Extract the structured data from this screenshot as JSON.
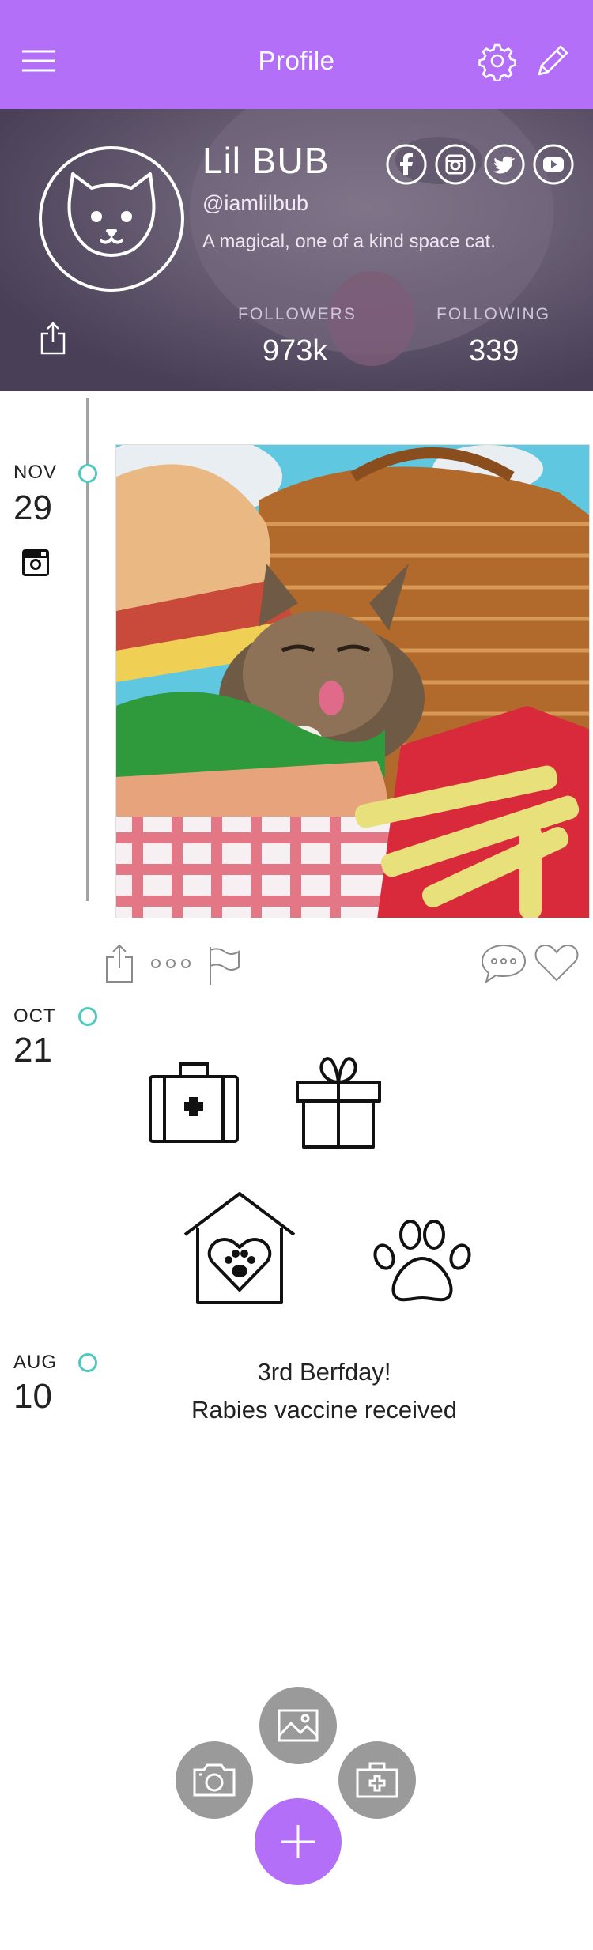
{
  "header": {
    "title": "Profile",
    "menu_icon": "hamburger-menu-icon",
    "settings_icon": "gear-icon",
    "edit_icon": "pencil-icon",
    "background_color": "#b36ff8"
  },
  "profile": {
    "name": "Lil BUB",
    "handle": "@iamlilbub",
    "bio": "A magical, one of a kind space cat.",
    "avatar_icon": "cat-face-icon",
    "socials": [
      "facebook-icon",
      "instagram-icon",
      "twitter-icon",
      "youtube-icon"
    ],
    "followers_label": "FOLLOWERS",
    "followers_value": "973k",
    "following_label": "FOLLOWING",
    "following_value": "339"
  },
  "timeline": {
    "accent_color": "#4fc9bd",
    "entries": [
      {
        "month": "NOV",
        "day": "29",
        "source_icon": "instagram-icon",
        "type": "photo"
      },
      {
        "month": "OCT",
        "day": "21",
        "type": "icons",
        "icons": [
          "medical-kit-icon",
          "gift-icon",
          "pet-house-icon",
          "paw-icon"
        ]
      },
      {
        "month": "AUG",
        "day": "10",
        "type": "text",
        "lines": [
          "3rd Berfday!",
          "Rabies vaccine received"
        ]
      }
    ],
    "post_actions": [
      "share-icon",
      "more-dots-icon",
      "flag-icon",
      "comment-icon",
      "heart-icon"
    ]
  },
  "fab": {
    "main_icon": "plus-icon",
    "options": [
      "camera-icon",
      "image-icon",
      "medical-kit-icon"
    ],
    "main_color": "#b36ff8",
    "option_color": "#9a9a9a"
  }
}
